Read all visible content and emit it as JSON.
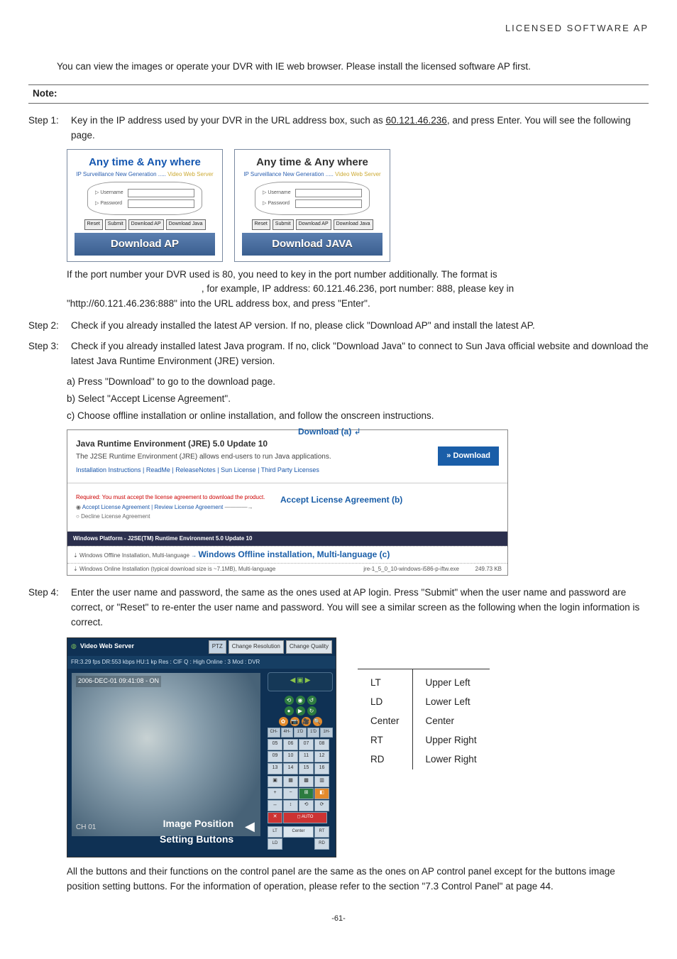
{
  "header": {
    "right": "LICENSED  SOFTWARE  AP"
  },
  "intro": "You can view the images or operate your DVR with IE web browser. Please install the licensed software AP first.",
  "note_label": "Note:",
  "steps": {
    "s1": {
      "label": "Step 1:",
      "body_a": "Key in the IP address used by your DVR in the URL address box, such as ",
      "ip": "60.121.46.236",
      "body_b": ", and press Enter. You will see the following page."
    },
    "s2": {
      "label": "Step 2:",
      "body": "Check if you already installed the latest AP version. If no, please click \"Download AP\" and install the latest AP."
    },
    "s3": {
      "label": "Step 3:",
      "body": "Check if you already installed latest Java program. If no, click \"Download Java\" to connect to Sun Java official website and download the latest Java Runtime Environment (JRE) version.",
      "a": "a)  Press \"Download\" to go to the download page.",
      "b": "b)  Select \"Accept License Agreement\".",
      "c": "c)  Choose offline installation or online installation, and follow the onscreen instructions."
    },
    "s4": {
      "label": "Step 4:",
      "body": "Enter the user name and password, the same as the ones used at AP login. Press \"Submit\" when the user name and password are correct, or \"Reset\" to re-enter the user name and password. You will see a similar screen as the following when the login information is correct."
    }
  },
  "login_card": {
    "title": "Any time & Any where",
    "sub_a": "IP Surveillance New Generation",
    "sub_b": "Video Web Server",
    "username": "Username",
    "password": "Password",
    "reset": "Reset",
    "submit": "Submit",
    "dl_ap": "Download AP",
    "dl_java": "Download Java",
    "bar_ap": "Download AP",
    "bar_java": "Download JAVA"
  },
  "port_note": {
    "a": "If the port number your DVR used is            80, you need to key in the port number additionally. The format is",
    "b": ", for example, IP address: 60.121.46.236, port number: 888, please key in",
    "c": "\"http://60.121.46.236:888\" into the URL address box, and press \"Enter\"."
  },
  "dl_panel": {
    "a_label": "Download (a)",
    "title": "Java Runtime Environment (JRE) 5.0 Update 10",
    "sub": "The J2SE Runtime Environment (JRE) allows end-users to run Java applications.",
    "links": "Installation Instructions | ReadMe | ReleaseNotes | Sun License | Third Party Licenses",
    "dl_btn": "» Download",
    "required": "Required: You must accept the license agreement to download the product.",
    "accept_line": "Accept License Agreement   |   Review License Agreement",
    "decline": "Decline License Agreement",
    "accept_b": "Accept License Agreement (b)",
    "darkbar": "Windows Platform - J2SE(TM) Runtime Environment 5.0 Update 10",
    "row1_l": "Windows Offline Installation, Multi-language",
    "offline_c": "Windows Offline installation, Multi-language (c)",
    "row1_r": "jre-1_5_0_10-windows-i586-p-iftw.exe",
    "row1_size": "249.73 KB",
    "row2_l": "Windows Online Installation (typical download size is ~7.1MB), Multi-language"
  },
  "viewer": {
    "title": "Video Web Server",
    "ptz": "PTZ",
    "chg_res": "Change Resolution",
    "chg_qual": "Change Quality",
    "status": "FR:3.29 fps  DR:553 kbps  HU:1 kp  Res : CIF  Q : High  Online : 3  Mod : DVR",
    "ts": "2006-DEC-01   09:41:08   -   ON",
    "ch": "CH 01",
    "bar_labels": [
      "CH-",
      "4H-",
      "1'D",
      "1'D",
      "1H-"
    ],
    "nums": [
      "05",
      "06",
      "07",
      "08",
      "09",
      "10",
      "11",
      "12",
      "13",
      "14",
      "15",
      "16"
    ],
    "pos": [
      "LT",
      "LD",
      "Center",
      "RT",
      "RD"
    ],
    "caption_a": "Image Position",
    "caption_b": "Setting Buttons"
  },
  "pos_table": {
    "rows": [
      {
        "k": "LT",
        "v": "Upper Left"
      },
      {
        "k": "LD",
        "v": "Lower Left"
      },
      {
        "k": "Center",
        "v": "Center"
      },
      {
        "k": "RT",
        "v": "Upper Right"
      },
      {
        "k": "RD",
        "v": "Lower Right"
      }
    ]
  },
  "final": "All the buttons and their functions on the control panel are the same as the ones on AP control panel except for the buttons image position setting buttons. For the information of operation, please refer to the section \"7.3 Control Panel\" at page 44.",
  "page_num": "-61-"
}
